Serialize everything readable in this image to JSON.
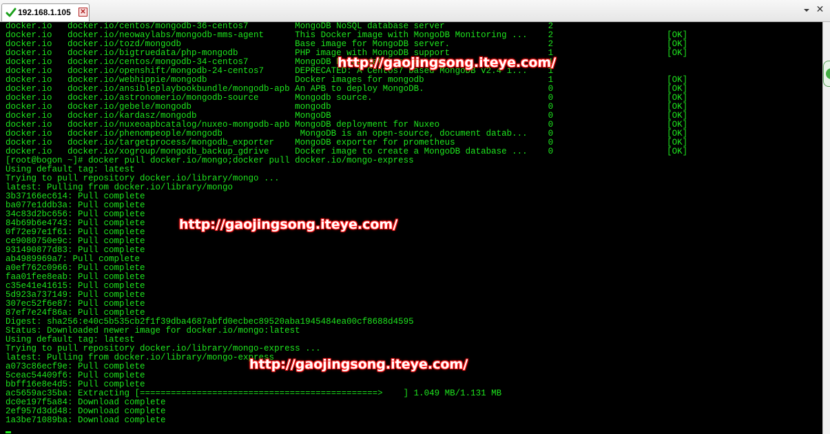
{
  "tab": {
    "label": "192.168.1.105",
    "close_glyph": "✕"
  },
  "window": {
    "close_glyph": "✕"
  },
  "colors": {
    "terminal_bg": "#000000",
    "terminal_fg": "#1ee61e",
    "watermark": "#ff2020"
  },
  "terminal": {
    "lines": [
      "docker.io   docker.io/centos/mongodb-36-centos7         MongoDB NoSQL database server                    2",
      "docker.io   docker.io/neowaylabs/mongodb-mms-agent      This Docker image with MongoDB Monitoring ...    2                      [OK]",
      "docker.io   docker.io/tozd/mongodb                      Base image for MongoDB server.                   2                      [OK]",
      "docker.io   docker.io/bigtruedata/php-mongodb           PHP image with MongoDB support                   1                      [OK]",
      "docker.io   docker.io/centos/mongodb-34-centos7         MongoDB NoSQL database server                    1",
      "docker.io   docker.io/openshift/mongodb-24-centos7      DEPRECATED: A Centos7 based MongoDB v2.4 i...    1",
      "docker.io   docker.io/webhippie/mongodb                 Docker images for mongodb                        1                      [OK]",
      "docker.io   docker.io/ansibleplaybookbundle/mongodb-apb An APB to deploy MongoDB.                        0                      [OK]",
      "docker.io   docker.io/astronomerio/mongodb-source       Mongodb source.                                  0                      [OK]",
      "docker.io   docker.io/gebele/mongodb                    mongodb                                          0                      [OK]",
      "docker.io   docker.io/kardasz/mongodb                   MongoDB                                          0                      [OK]",
      "docker.io   docker.io/nuxeoapbcatalog/nuxeo-mongodb-apb MongoDB deployment for Nuxeo                     0                      [OK]",
      "docker.io   docker.io/phenompeople/mongodb               MongoDB is an open-source, document datab...    0                      [OK]",
      "docker.io   docker.io/targetprocess/mongodb_exporter    MongoDB exporter for prometheus                  0                      [OK]",
      "docker.io   docker.io/xogroup/mongodb_backup_gdrive     Docker image to create a MongoDB database ...    0                      [OK]",
      "[root@bogon ~]# docker pull docker.io/mongo;docker pull docker.io/mongo-express",
      "Using default tag: latest",
      "Trying to pull repository docker.io/library/mongo ...",
      "latest: Pulling from docker.io/library/mongo",
      "3b37166ec614: Pull complete",
      "ba077e1ddb3a: Pull complete",
      "34c83d2bc656: Pull complete",
      "84b69b6e4743: Pull complete",
      "0f72e97e1f61: Pull complete",
      "ce9080750e9c: Pull complete",
      "931490877d83: Pull complete",
      "ab4989969a7: Pull complete",
      "a0ef762c0966: Pull complete",
      "faa01fee8eab: Pull complete",
      "c35e41e41615: Pull complete",
      "5d923a737149: Pull complete",
      "307ec52f6e87: Pull complete",
      "87ef7e24f86a: Pull complete",
      "Digest: sha256:e40c5b535cb2f1f39dba4687abfd0ecbec89520aba1945484ea00cf8688d4595",
      "Status: Downloaded newer image for docker.io/mongo:latest",
      "Using default tag: latest",
      "Trying to pull repository docker.io/library/mongo-express ...",
      "latest: Pulling from docker.io/library/mongo-express",
      "a073c86ecf9e: Pull complete",
      "5ceac54409f6: Pull complete",
      "bbff16e8e4d5: Pull complete",
      "ac5659ac35ba: Extracting [==============================================>    ] 1.049 MB/1.131 MB",
      "dc0e197f5a84: Download complete",
      "2ef957d3dd48: Download complete",
      "1a3be71089ba: Download complete"
    ]
  },
  "watermarks": [
    "http://gaojingsong.iteye.com/",
    "http://gaojingsong.iteye.com/",
    "http://gaojingsong.iteye.com/"
  ]
}
